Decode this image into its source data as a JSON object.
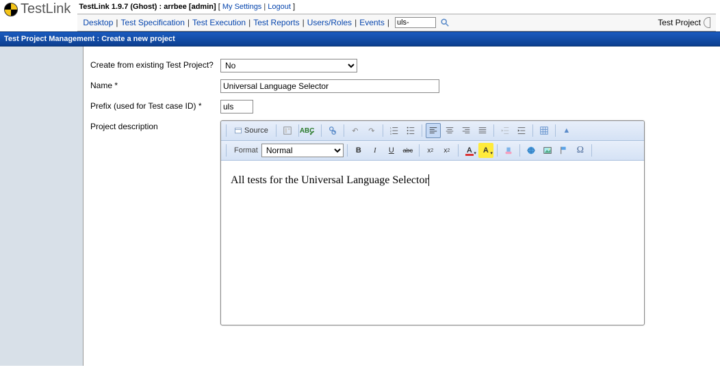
{
  "app": {
    "name": "TestLink",
    "version_line": "TestLink 1.9.7 (Ghost) : arrbee [admin]",
    "my_settings": "My Settings",
    "logout": "Logout"
  },
  "nav": {
    "desktop": "Desktop",
    "test_spec": "Test Specification",
    "test_exec": "Test Execution",
    "test_reports": "Test Reports",
    "users_roles": "Users/Roles",
    "events": "Events",
    "search_value": "uls-",
    "project_label": "Test Project"
  },
  "bluebar": {
    "title": "Test Project Management : Create a new project"
  },
  "form": {
    "create_from_label": "Create from existing Test Project?",
    "create_from_value": "No",
    "name_label": "Name *",
    "name_value": "Universal Language Selector",
    "prefix_label": "Prefix (used for Test case ID) *",
    "prefix_value": "uls",
    "desc_label": "Project description"
  },
  "editor": {
    "source": "Source",
    "format_label": "Format",
    "format_value": "Normal",
    "body_text": "All tests for the Universal Language Selector"
  }
}
